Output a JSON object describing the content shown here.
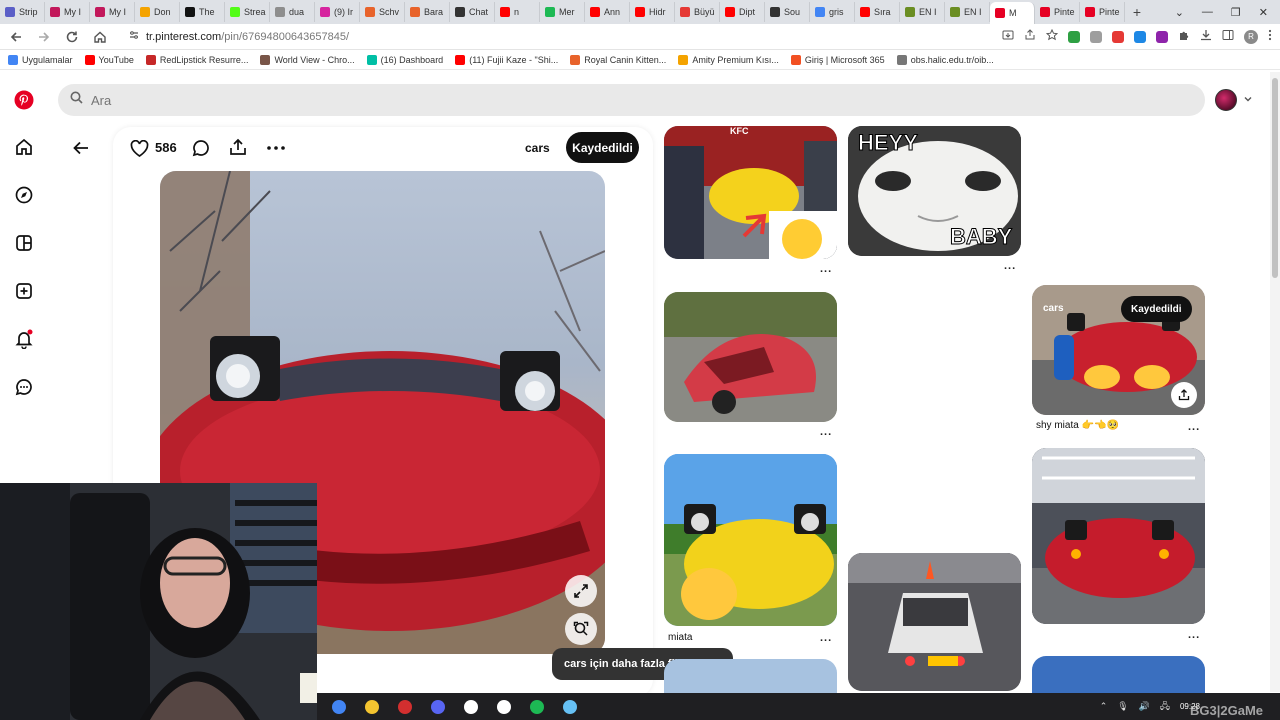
{
  "browser": {
    "tabs": [
      {
        "label": "Strip",
        "color": "#5b5fc7"
      },
      {
        "label": "My I",
        "color": "#c2185b"
      },
      {
        "label": "My I",
        "color": "#c2185b"
      },
      {
        "label": "Don",
        "color": "#f4a300"
      },
      {
        "label": "The",
        "color": "#111111"
      },
      {
        "label": "Strea",
        "color": "#53fc18"
      },
      {
        "label": "dua",
        "color": "#8e8e8e"
      },
      {
        "label": "(9) Ir",
        "color": "#d6249f"
      },
      {
        "label": "Schv",
        "color": "#e8632b"
      },
      {
        "label": "Bara",
        "color": "#e8632b"
      },
      {
        "label": "Chat",
        "color": "#333333"
      },
      {
        "label": "n",
        "color": "#ff0000"
      },
      {
        "label": "Mer",
        "color": "#1db954"
      },
      {
        "label": "Ann",
        "color": "#ff0000"
      },
      {
        "label": "Hidr",
        "color": "#ff0000"
      },
      {
        "label": "Büyü",
        "color": "#e53935"
      },
      {
        "label": "Dipt",
        "color": "#ff0000"
      },
      {
        "label": "Sou",
        "color": "#333333"
      },
      {
        "label": "gris",
        "color": "#4285f4"
      },
      {
        "label": "Sıra",
        "color": "#ff0000"
      },
      {
        "label": "EN I",
        "color": "#6b8e23"
      },
      {
        "label": "EN I",
        "color": "#6b8e23"
      },
      {
        "label": "M",
        "color": "#e60023"
      },
      {
        "label": "Pinte",
        "color": "#e60023"
      },
      {
        "label": "Pinte",
        "color": "#e60023"
      }
    ],
    "active_tab_index": 22,
    "new_tab": "+",
    "url_host": "tr.pinterest.com",
    "url_path": "/pin/676948006436578​45/",
    "bookmarks": [
      {
        "label": "Uygulamalar",
        "color": "#4285f4"
      },
      {
        "label": "YouTube",
        "color": "#ff0000"
      },
      {
        "label": "RedLipstick Resurre...",
        "color": "#c62828"
      },
      {
        "label": "World View - Chro...",
        "color": "#795548"
      },
      {
        "label": "(16) Dashboard",
        "color": "#00bfa5"
      },
      {
        "label": "(11) Fujii Kaze - \"Shi...",
        "color": "#ff0000"
      },
      {
        "label": "Royal Canin Kitten...",
        "color": "#e8632b"
      },
      {
        "label": "Amity Premium Kısı...",
        "color": "#f4a300"
      },
      {
        "label": "Giriş | Microsoft 365",
        "color": "#f25022"
      },
      {
        "label": "obs.halic.edu.tr/oib...",
        "color": "#777777"
      }
    ]
  },
  "pinterest": {
    "brand_color": "#e60023",
    "search_placeholder": "Ara",
    "pin": {
      "likes": "586",
      "board": "cars",
      "saved_label": "Kaydedildi",
      "more_ideas": "cars için daha fazla fikir bulun"
    },
    "grid": {
      "kfc_text": "KFC",
      "heyy_text": "HEYY",
      "baby_text": "BABY",
      "hover_board": "cars",
      "hover_saved": "Kaydedildi",
      "shy_title": "shy miata 👉👈🥺",
      "miata_title": "miata",
      "dots": "..."
    }
  },
  "taskbar": {
    "apps": [
      {
        "name": "chrome",
        "color": "#4285f4"
      },
      {
        "name": "files",
        "color": "#f4c430"
      },
      {
        "name": "voicemeeter",
        "color": "#d32f2f"
      },
      {
        "name": "discord",
        "color": "#5865f2"
      },
      {
        "name": "chatgpt",
        "color": "#ffffff"
      },
      {
        "name": "obs",
        "color": "#ffffff"
      },
      {
        "name": "spotify",
        "color": "#1db954"
      },
      {
        "name": "steam",
        "color": "#66c0f4"
      }
    ],
    "clock_time": "09:28",
    "watermark": "BG3|2GaMe"
  }
}
